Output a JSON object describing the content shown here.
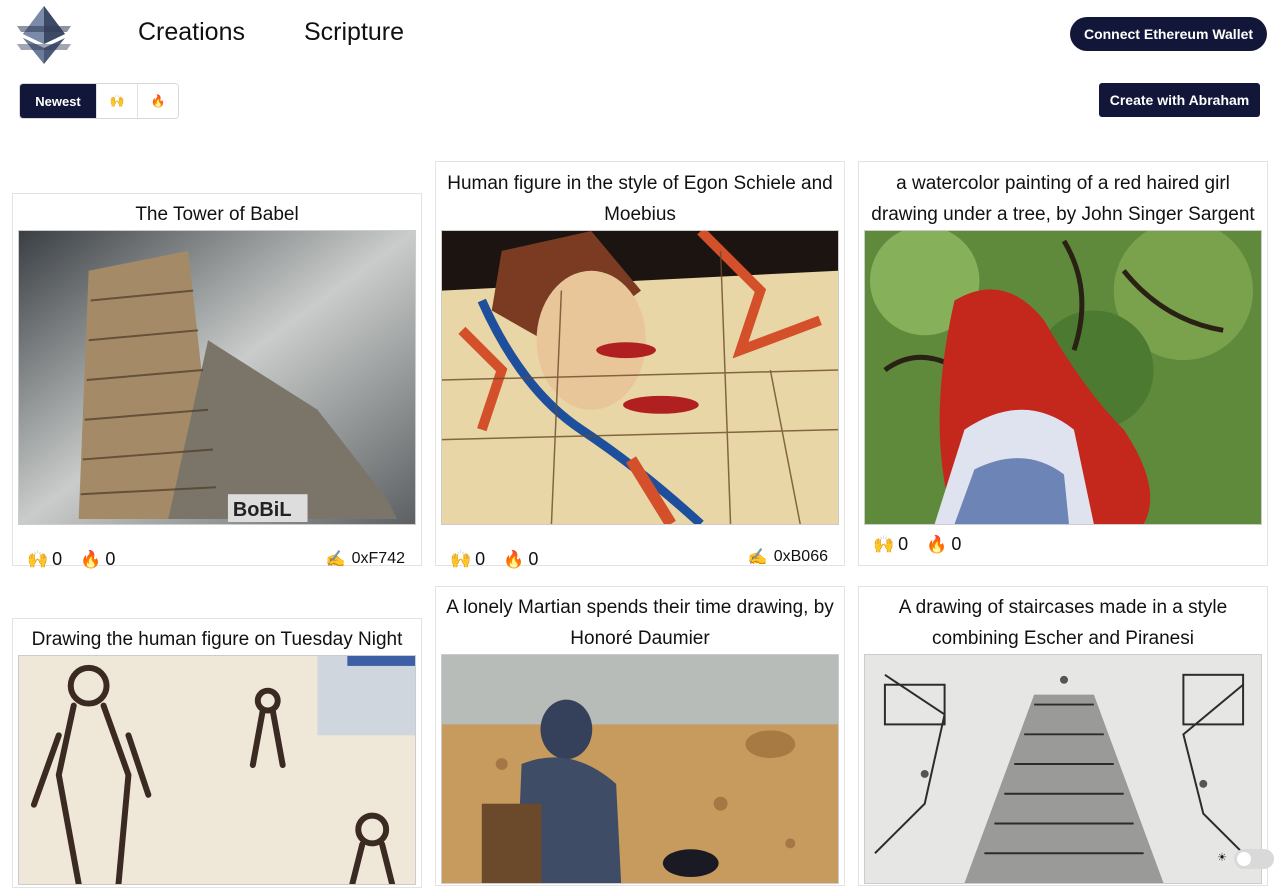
{
  "header": {
    "nav": [
      {
        "label": "Creations"
      },
      {
        "label": "Scripture"
      }
    ],
    "wallet_label": "Connect Ethereum Wallet"
  },
  "sort": {
    "active_label": "Newest",
    "praise_icon": "🙌",
    "burn_icon": "🔥"
  },
  "create_label": "Create with Abraham",
  "icons": {
    "praise": "🙌",
    "burn": "🔥",
    "author": "✍️"
  },
  "cards": [
    {
      "title": "The Tower of Babel",
      "praises": "0",
      "burns": "0",
      "author": "0xF742"
    },
    {
      "title": "Human figure in the style of Egon Schiele and Moebius",
      "praises": "0",
      "burns": "0",
      "author": "0xB066"
    },
    {
      "title": "a watercolor painting of a red haired girl drawing under a tree, by John Singer Sargent",
      "praises": "0",
      "burns": "0",
      "author": ""
    },
    {
      "title": "Drawing the human figure on Tuesday Night"
    },
    {
      "title": "A lonely Martian spends their time drawing, by Honoré Daumier"
    },
    {
      "title": "A drawing of staircases made in a style combining Escher and Piranesi"
    }
  ],
  "colors": {
    "primary": "#12173a"
  }
}
